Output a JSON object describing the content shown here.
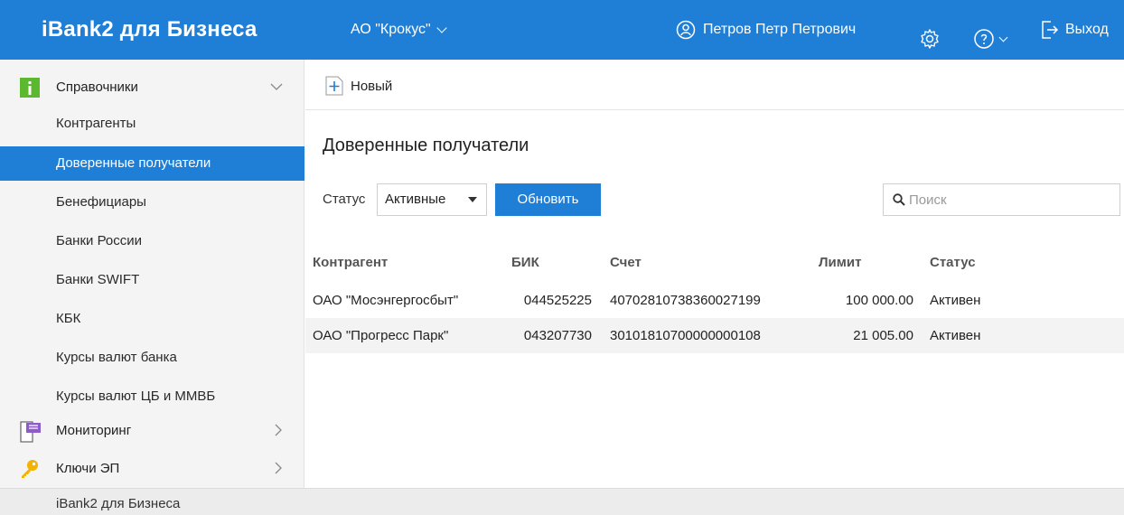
{
  "header": {
    "brand": "iBank2 для Бизнеса",
    "organization": "АО \"Крокус\"",
    "user_name": "Петров Петр Петрович",
    "logout_label": "Выход"
  },
  "sidebar": {
    "group_directories": "Справочники",
    "items": [
      {
        "label": "Контрагенты"
      },
      {
        "label": "Доверенные получатели"
      },
      {
        "label": "Бенефициары"
      },
      {
        "label": "Банки России"
      },
      {
        "label": "Банки SWIFT"
      },
      {
        "label": "КБК"
      },
      {
        "label": "Курсы валют банка"
      },
      {
        "label": "Курсы валют ЦБ и ММВБ"
      }
    ],
    "group_monitoring": "Мониторинг",
    "group_keys": "Ключи ЭП"
  },
  "footer": {
    "text": "iBank2 для Бизнеса"
  },
  "toolbar": {
    "new_label": "Новый"
  },
  "main": {
    "title": "Доверенные получатели",
    "status_label": "Статус",
    "status_value": "Активные",
    "refresh_label": "Обновить",
    "search_placeholder": "Поиск"
  },
  "table": {
    "columns": [
      "Контрагент",
      "БИК",
      "Счет",
      "Лимит",
      "Статус"
    ],
    "rows": [
      {
        "name": "ОАО \"Мосэнгергосбыт\"",
        "bik": "044525225",
        "account": "40702810738360027199",
        "limit": "100 000.00",
        "status": "Активен"
      },
      {
        "name": "ОАО \"Прогресс Парк\"",
        "bik": "043207730",
        "account": "30101810700000000108",
        "limit": "21 005.00",
        "status": "Активен"
      }
    ]
  },
  "colors": {
    "accent": "#1f7fd6",
    "status_active": "#1b8a1b"
  },
  "icons": [
    "info-icon",
    "chevron-down-icon",
    "user-circle-icon",
    "gear-icon",
    "help-icon",
    "logout-icon",
    "plus-icon",
    "monitor-icon",
    "key-icon",
    "chevron-right-icon",
    "search-icon"
  ]
}
